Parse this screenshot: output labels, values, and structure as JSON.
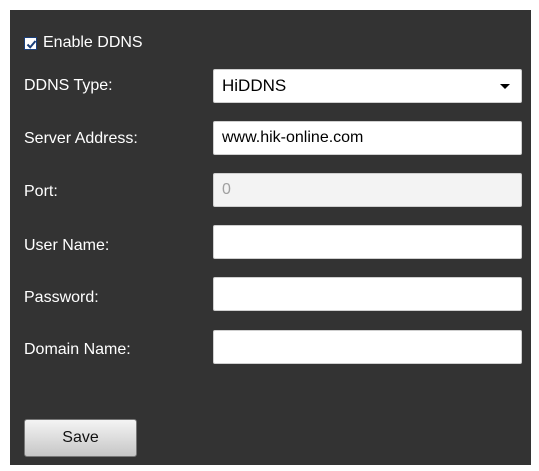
{
  "ddns": {
    "enable_label": "Enable DDNS",
    "enabled": true,
    "type_label": "DDNS Type:",
    "type_value": "HiDDNS",
    "server_label": "Server Address:",
    "server_value": "www.hik-online.com",
    "port_label": "Port:",
    "port_value": "0",
    "username_label": "User Name:",
    "username_value": "",
    "password_label": "Password:",
    "password_value": "",
    "domain_label": "Domain Name:",
    "domain_value": ""
  },
  "actions": {
    "save_label": "Save"
  },
  "colors": {
    "panel_background": "#333333",
    "label_text": "#ffffff",
    "checkbox_check": "#1a3f7a"
  },
  "icons": {
    "checkbox": "checkmark-icon",
    "select_arrow": "chevron-down-icon"
  }
}
